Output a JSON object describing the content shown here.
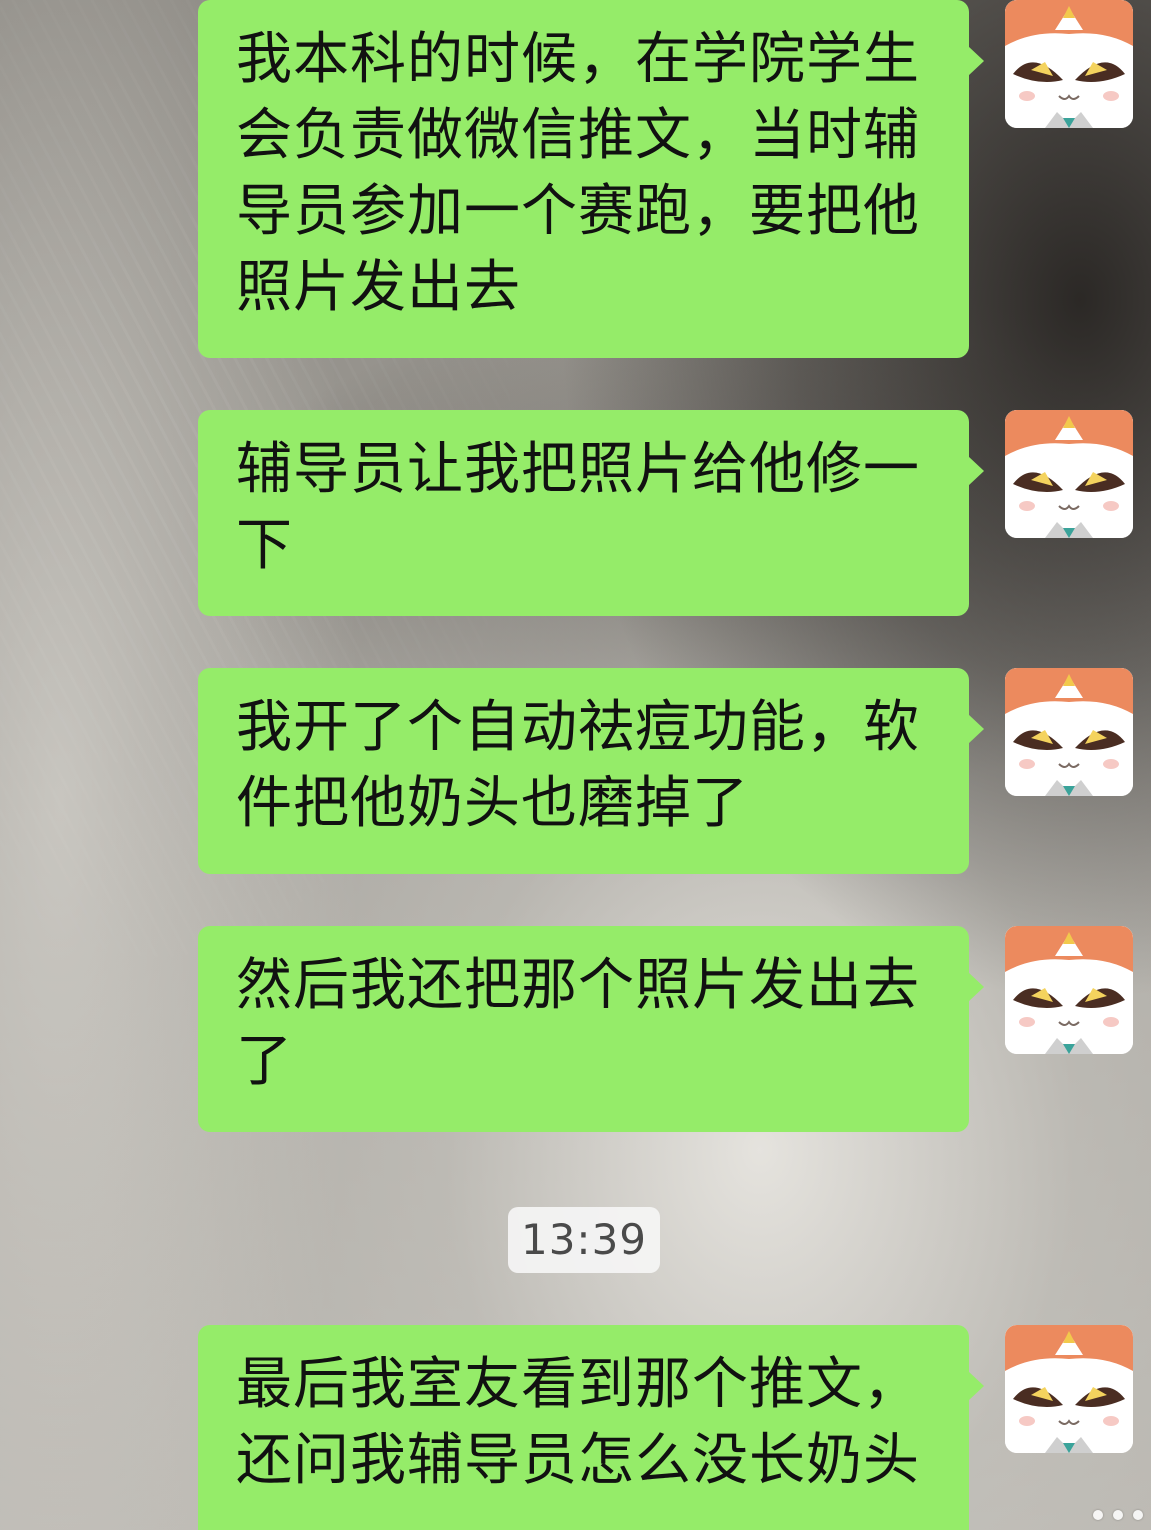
{
  "chat": {
    "messages": [
      {
        "text": "我本科的时候，在学院学生\n会负责做微信推文，当时辅\n导员参加一个赛跑，要把他\n照片发出去"
      },
      {
        "text": "辅导员让我把照片给他修一\n下"
      },
      {
        "text": "我开了个自动祛痘功能，软\n件把他奶头也磨掉了"
      },
      {
        "text": "然后我还把那个照片发出去\n了"
      },
      {
        "text": "最后我室友看到那个推文，\n还问我辅导员怎么没长奶头"
      }
    ],
    "timestamp": "13:39"
  },
  "style": {
    "bubble_color": "#95ec69",
    "text_color": "#111111",
    "timestamp_bg": "#f5f5f5",
    "avatar_icon": "cartoon-cat-avatar-icon"
  }
}
